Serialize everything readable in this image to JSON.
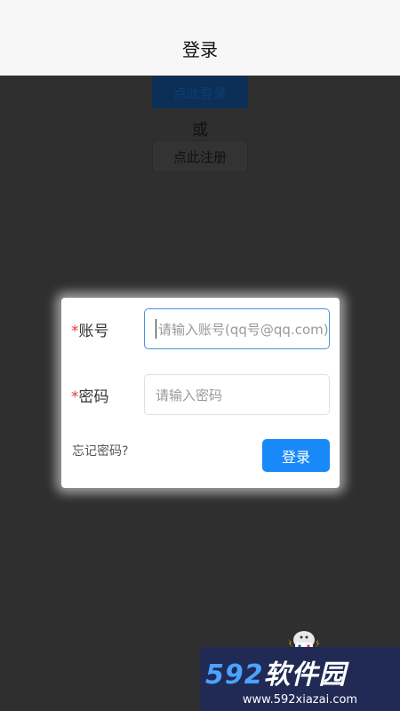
{
  "header": {
    "title": "登录"
  },
  "background": {
    "login_button": "点此登录",
    "or_text": "或",
    "register_button": "点此注册"
  },
  "dialog": {
    "account_label": "账号",
    "account_required": "*",
    "account_placeholder": "请输入账号(qq号@qq.com)",
    "password_label": "密码",
    "password_required": "*",
    "password_placeholder": "请输入密码",
    "forgot_link": "忘记密码?",
    "login_button": "登录"
  },
  "watermark": {
    "brand_numbers": "592",
    "brand_text": "软件园",
    "url": "www.592xiazai.com"
  },
  "colors": {
    "primary": "#1989fa",
    "required": "#e53935",
    "overlay": "#2f2f2f"
  }
}
